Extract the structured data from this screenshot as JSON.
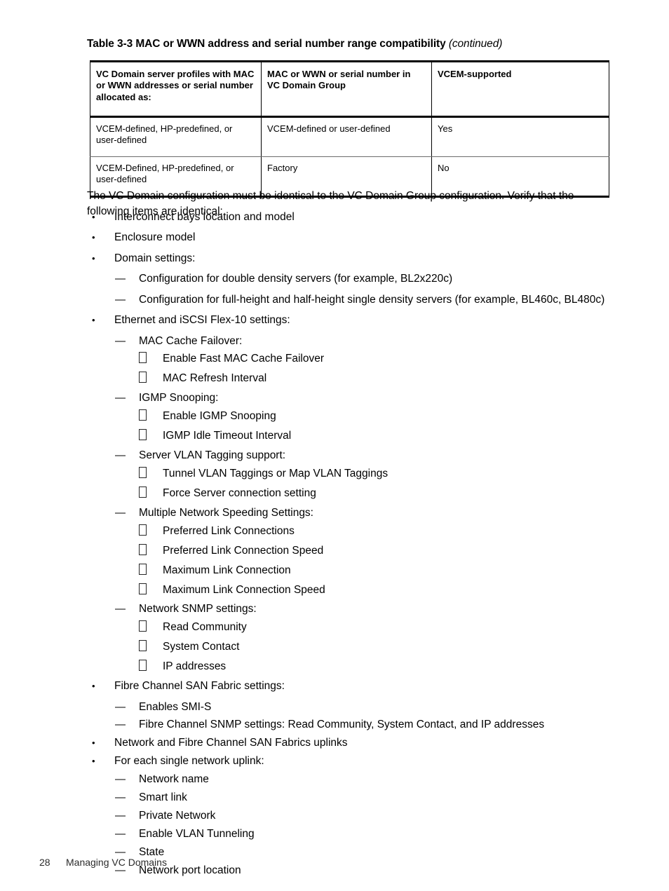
{
  "caption": {
    "main": "Table 3-3 MAC or WWN address and serial number range compatibility",
    "continued": "(continued)"
  },
  "table": {
    "headers": [
      "VC Domain server profiles with MAC or WWN addresses or serial number allocated as:",
      "MAC or WWN or serial number in VC Domain Group",
      "VCEM-supported"
    ],
    "rows": [
      [
        "VCEM-defined, HP-predefined, or user-defined",
        "VCEM-defined or user-defined",
        "Yes"
      ],
      [
        "VCEM-Defined, HP-predefined, or user-defined",
        "Factory",
        "No"
      ]
    ]
  },
  "intro": "The VC Domain configuration must be identical to the VC Domain Group configuration. Verify that the following items are identical:",
  "list": {
    "b1": "Interconnect bays location and model",
    "b2": "Enclosure model",
    "b3": "Domain settings:",
    "b3_d1": "Configuration for double density servers (for example, BL2x220c)",
    "b3_d2": "Configuration for full-height and half-height single density servers (for example, BL460c, BL480c)",
    "b4": "Ethernet and iSCSI Flex-10  settings:",
    "b4_d1": "MAC Cache Failover:",
    "b4_d1_s1": "Enable Fast MAC Cache Failover",
    "b4_d1_s2": "MAC Refresh Interval",
    "b4_d2": "IGMP Snooping:",
    "b4_d2_s1": "Enable IGMP Snooping",
    "b4_d2_s2": "IGMP Idle Timeout Interval",
    "b4_d3": "Server VLAN Tagging support:",
    "b4_d3_s1": "Tunnel VLAN Taggings or Map VLAN Taggings",
    "b4_d3_s2": "Force Server connection setting",
    "b4_d4": "Multiple Network Speeding Settings:",
    "b4_d4_s1": "Preferred Link Connections",
    "b4_d4_s2": "Preferred Link Connection Speed",
    "b4_d4_s3": "Maximum Link Connection",
    "b4_d4_s4": "Maximum Link Connection Speed",
    "b4_d5": "Network SNMP settings:",
    "b4_d5_s1": "Read Community",
    "b4_d5_s2": "System Contact",
    "b4_d5_s3": "IP addresses",
    "b5": "Fibre Channel SAN Fabric settings:",
    "b5_d1": "Enables SMI-S",
    "b5_d2": "Fibre Channel SNMP settings: Read Community, System Contact, and IP addresses",
    "b6": "Network and Fibre Channel SAN Fabrics uplinks",
    "b7": "For each single network uplink:",
    "b7_d1": "Network name",
    "b7_d2": "Smart link",
    "b7_d3": "Private Network",
    "b7_d4": "Enable VLAN Tunneling",
    "b7_d5": "State",
    "b7_d6": "Network port location"
  },
  "markers": {
    "bullet": "•",
    "dash": "—"
  },
  "footer": {
    "page_number": "28",
    "section": "Managing VC Domains"
  }
}
